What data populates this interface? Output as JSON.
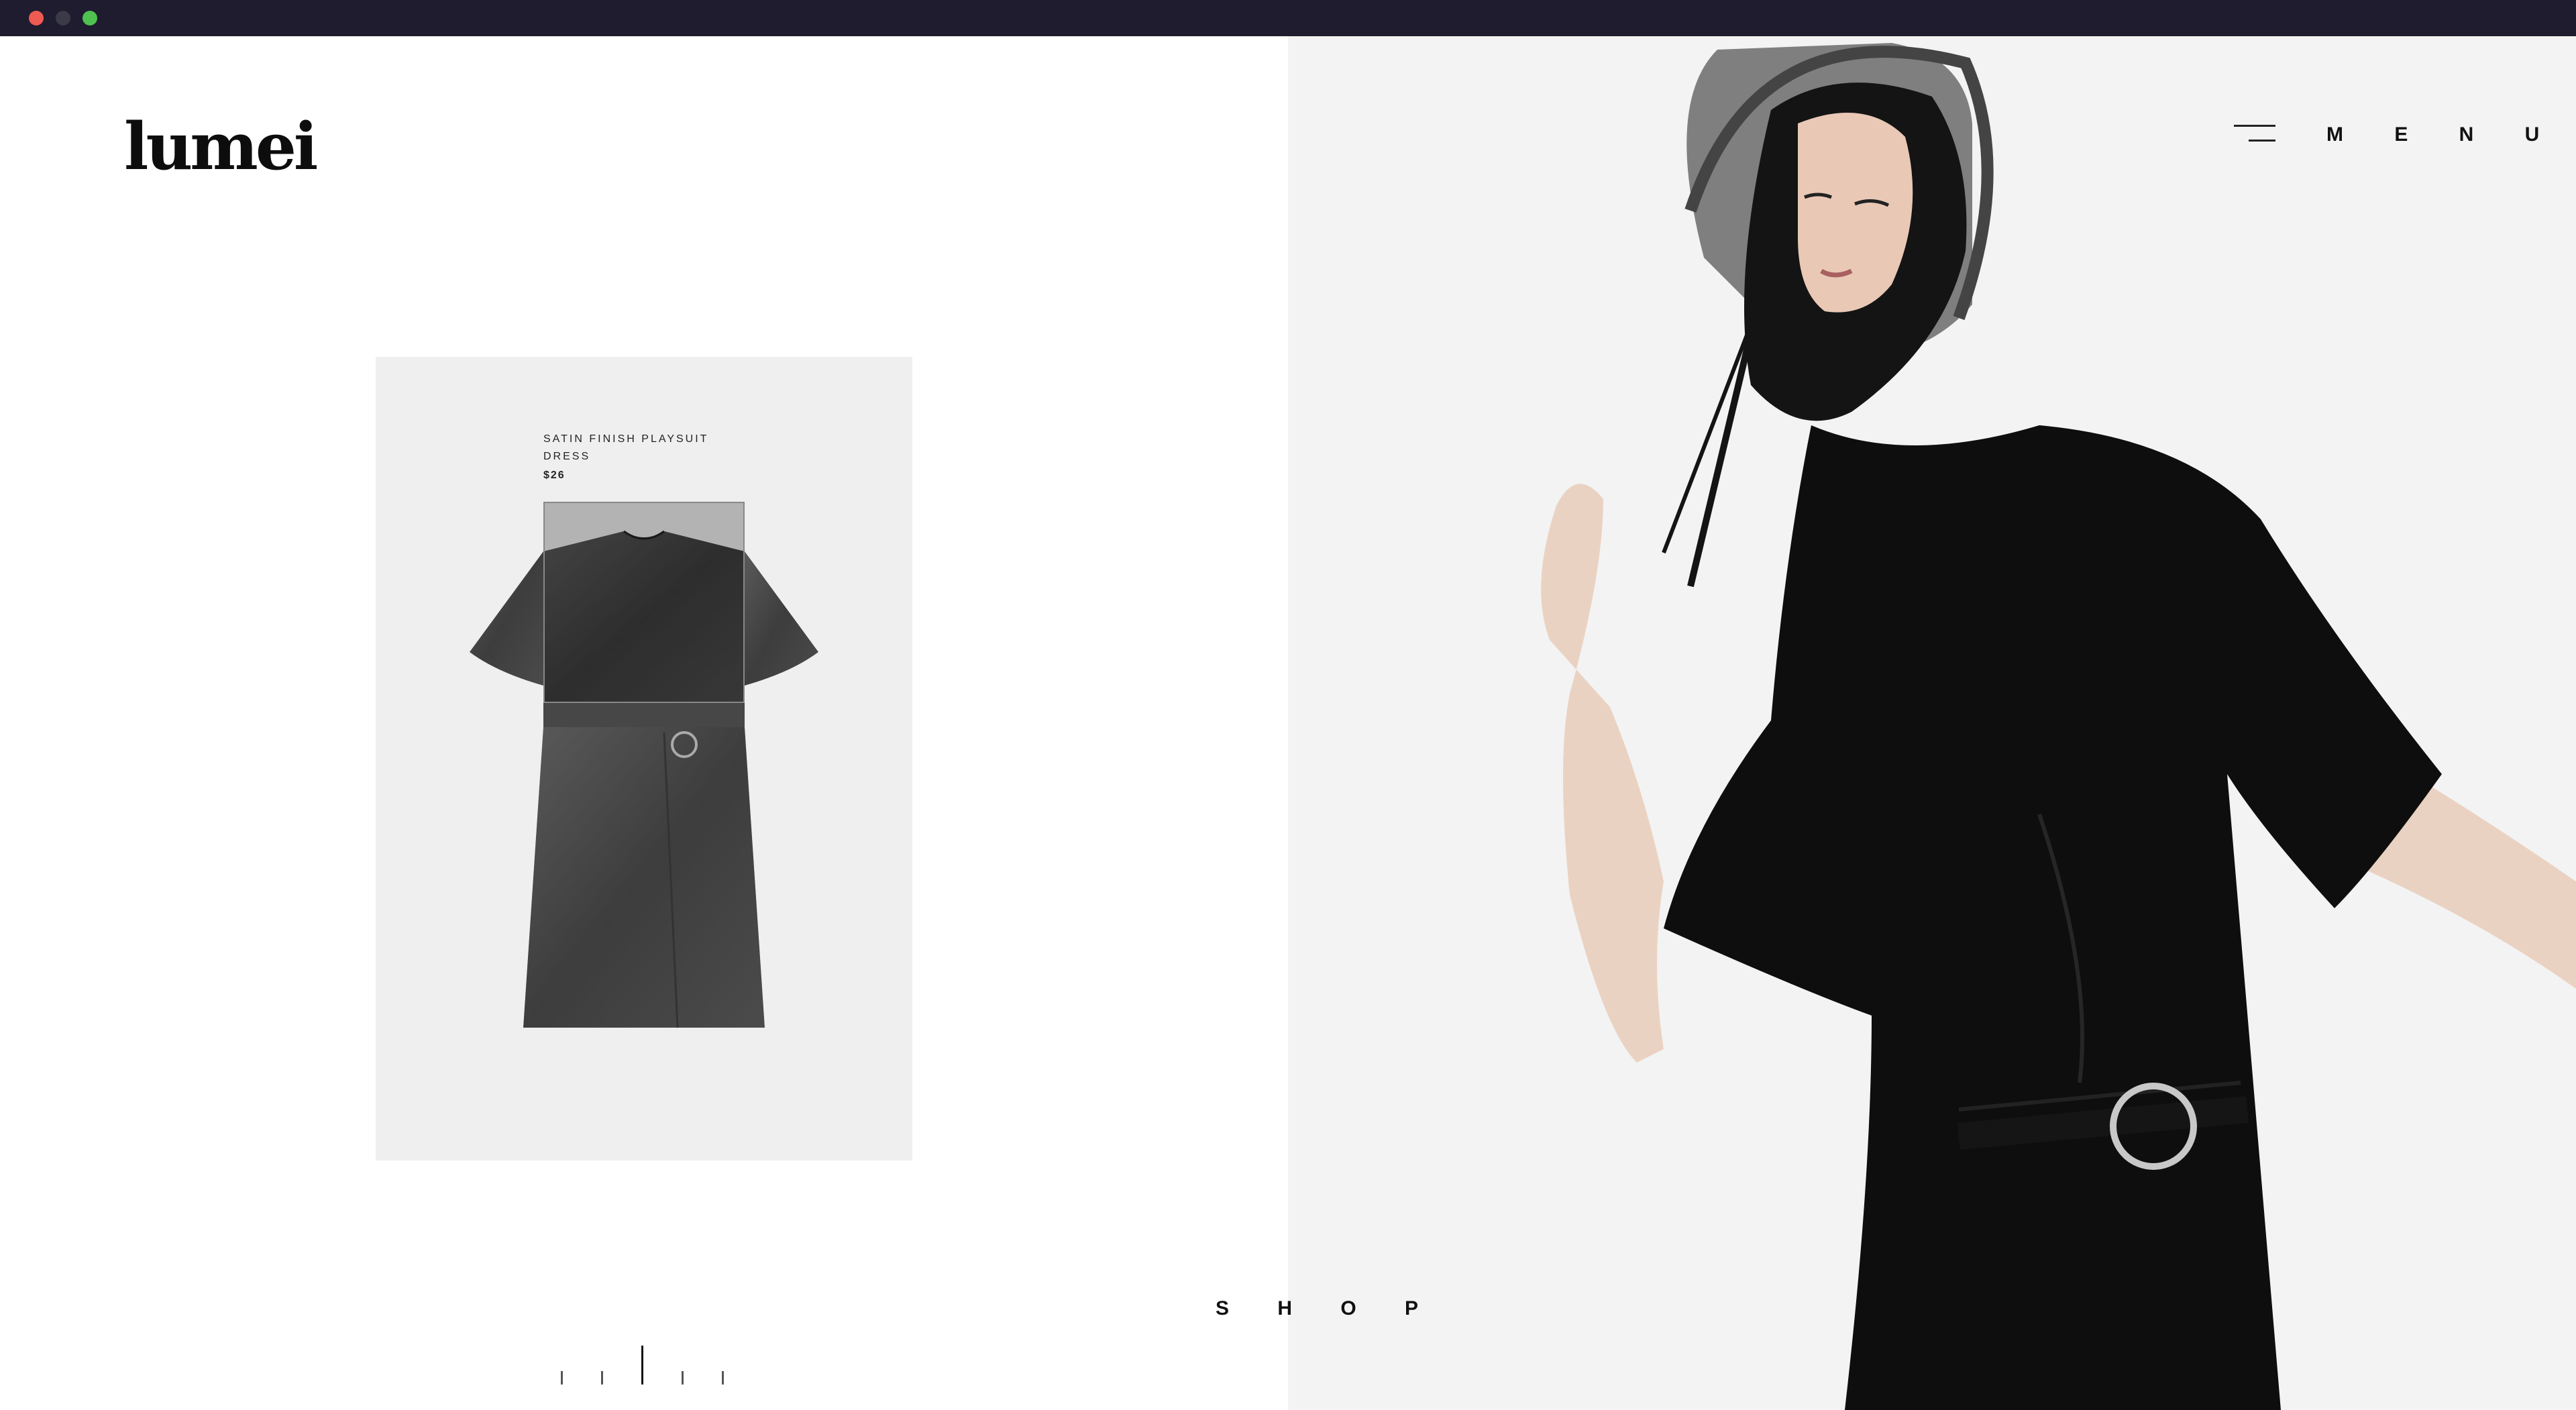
{
  "window": {
    "controls": [
      "close",
      "minimize",
      "maximize"
    ]
  },
  "brand": {
    "logo_text": "lumei"
  },
  "header": {
    "menu_label": "M E N U",
    "menu_icon": "hamburger-icon"
  },
  "product": {
    "name": "SATIN FINISH PLAYSUIT DRESS",
    "price": "$26",
    "image": "black-satin-dress"
  },
  "carousel": {
    "slide_count": 5,
    "active_index": 2
  },
  "cta": {
    "shop_label": "S H O P"
  },
  "hero": {
    "image": "model-in-black-dress-and-plaid-hat"
  },
  "colors": {
    "titlebar": "#1e1c2e",
    "accent_dark": "#111111",
    "card_bg": "#efefef",
    "hero_bg": "#f3f3f3"
  }
}
